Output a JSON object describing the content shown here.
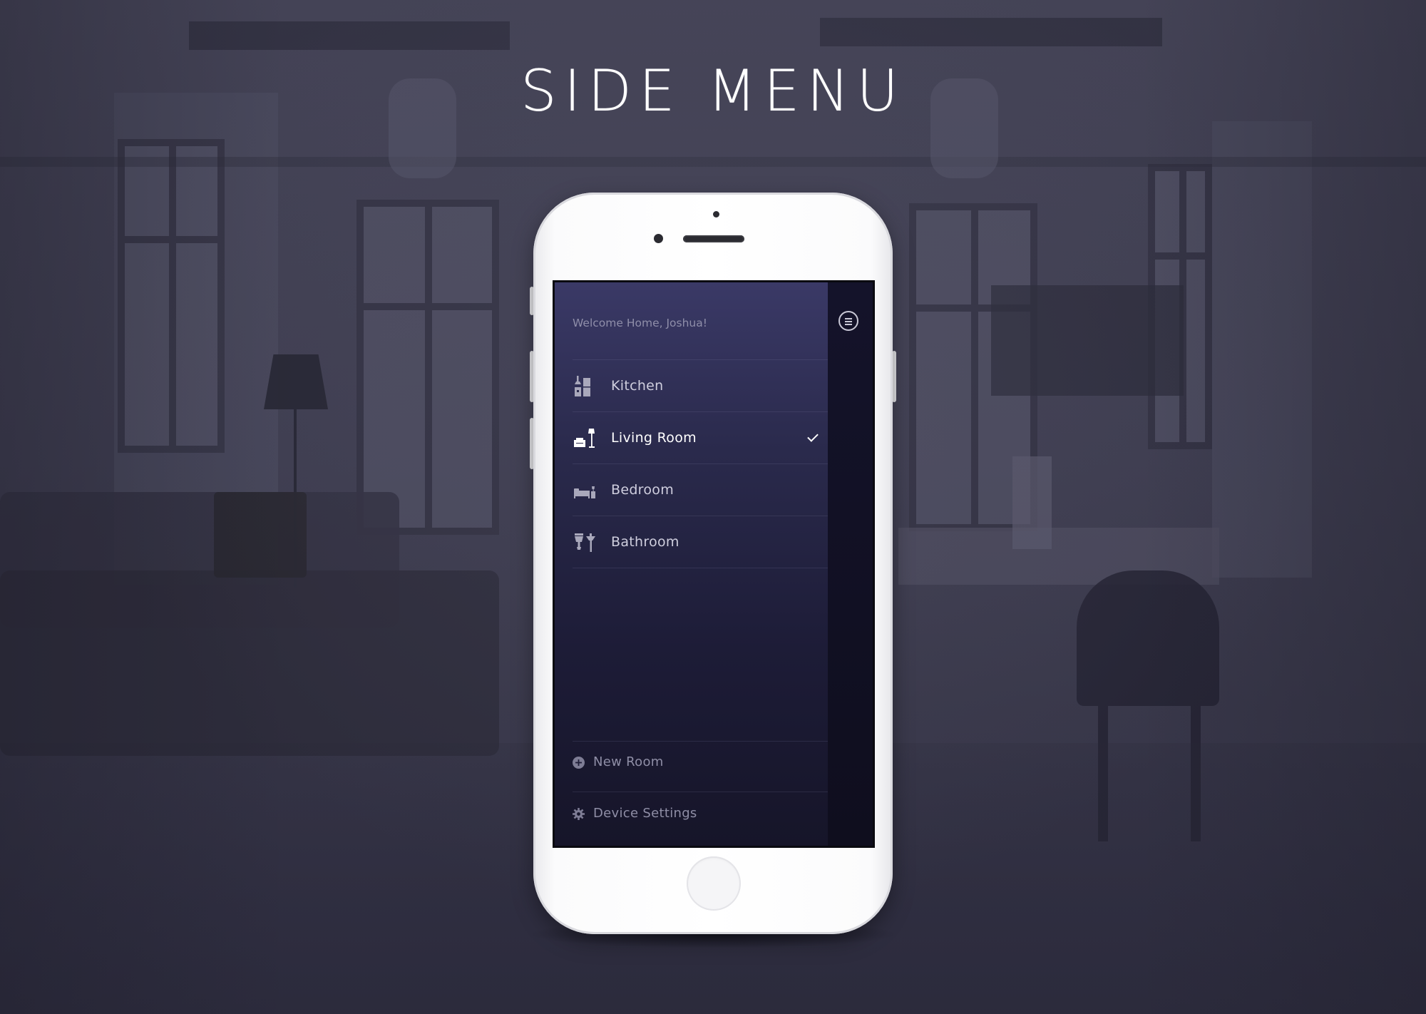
{
  "page": {
    "title": "SIDE MENU"
  },
  "app": {
    "welcome": "Welcome Home, Joshua!",
    "menu_icon": "hamburger-icon",
    "rooms": [
      {
        "label": "Kitchen",
        "icon": "kitchen-icon",
        "selected": false
      },
      {
        "label": "Living Room",
        "icon": "sofa-lamp-icon",
        "selected": true
      },
      {
        "label": "Bedroom",
        "icon": "bed-icon",
        "selected": false
      },
      {
        "label": "Bathroom",
        "icon": "sink-icon",
        "selected": false
      }
    ],
    "footer": {
      "new_room": {
        "label": "New Room",
        "icon": "plus-circle-icon"
      },
      "device_settings": {
        "label": "Device Settings",
        "icon": "gear-icon"
      }
    }
  },
  "colors": {
    "menu_top": "#3a3966",
    "menu_bottom": "#161529",
    "text_primary": "#ffffff",
    "text_muted": "#8f8ea9"
  }
}
